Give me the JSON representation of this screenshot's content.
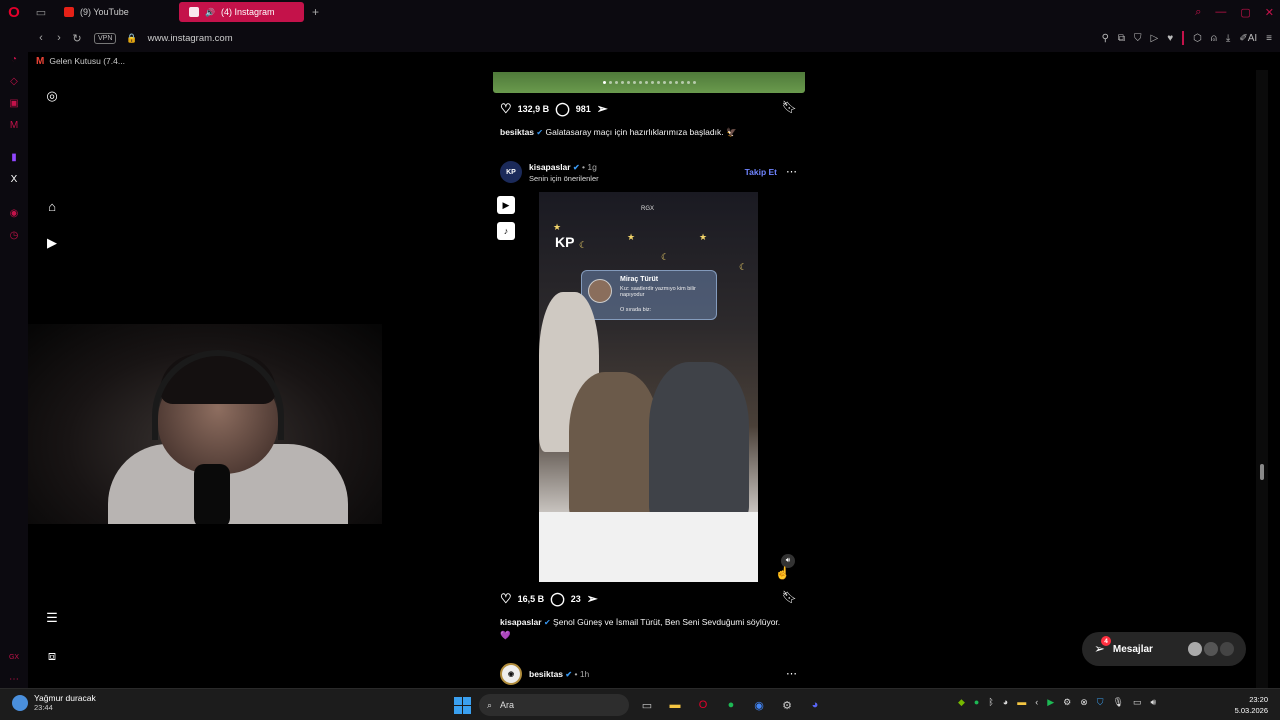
{
  "browser": {
    "tabs": [
      {
        "label": "(9) YouTube",
        "icon": "youtube-icon",
        "active": false
      },
      {
        "label": "(4) Instagram",
        "icon": "instagram-icon",
        "active": true
      }
    ],
    "url": "www.instagram.com",
    "vpn_label": "VPN",
    "bookmark": "Gelen Kutusu (7.4...",
    "accent_color": "#c4124a"
  },
  "posts": {
    "first": {
      "likes": "132,9 B",
      "comments": "981",
      "username": "besiktas",
      "caption": "Galatasaray maçı için hazırlıklarımıza başladık. 🦅"
    },
    "second": {
      "username": "kisapaslar",
      "time": "1g",
      "subtitle": "Senin için önerilenler",
      "follow_label": "Takip Et",
      "avatar_text": "KP",
      "overlay_logo": "KP",
      "overlay_brand": "RGX",
      "bubble_name": "Miraç Türüt",
      "bubble_text": "Kız: saatlerdir yazmıyo kim bilir napıyodur",
      "bubble_sub": "O sırada biz:",
      "likes": "16,5 B",
      "comments": "23",
      "caption": "Şenol Güneş ve İsmail Türüt, Ben Seni Sevduğumi söylüyor.",
      "caption_emoji": "💜"
    },
    "third": {
      "username": "besiktas",
      "time": "1h"
    }
  },
  "messages": {
    "label": "Mesajlar",
    "badge": "4"
  },
  "taskbar": {
    "weather_title": "Yağmur duracak",
    "weather_time": "23:44",
    "search_placeholder": "Ara",
    "time": "23:20",
    "date": "5.03.2026"
  }
}
